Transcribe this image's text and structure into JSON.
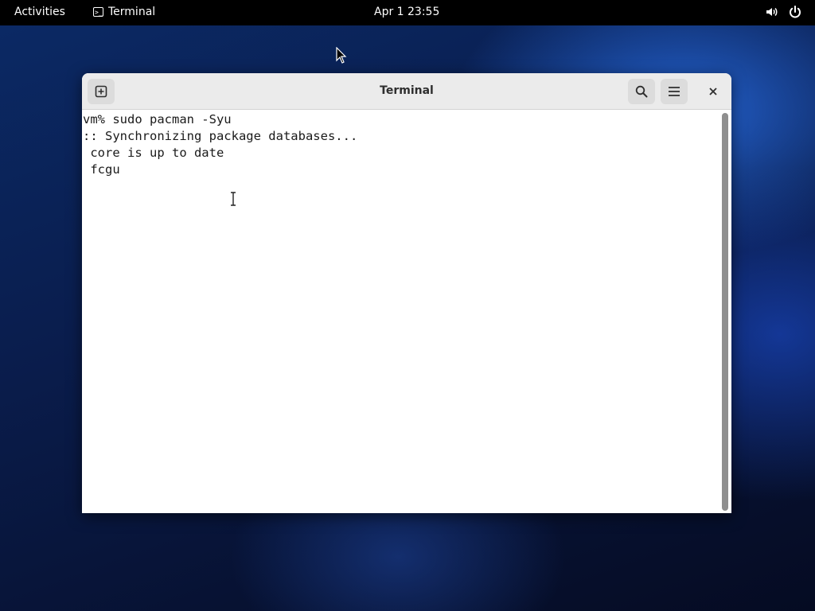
{
  "topbar": {
    "activities_label": "Activities",
    "app_name": "Terminal",
    "app_icon_glyph": ">_",
    "clock": "Apr 1  23:55",
    "volume_icon": "volume-icon",
    "power_icon": "power-icon"
  },
  "window": {
    "title": "Terminal",
    "buttons": {
      "new_tab_icon": "new-tab-icon",
      "search_icon": "search-icon",
      "menu_icon": "hamburger-menu-icon",
      "close_icon": "close-icon"
    }
  },
  "terminal": {
    "lines": [
      "vm% sudo pacman -Syu",
      ":: Synchronizing package databases...",
      " core is up to date",
      " fcgu"
    ]
  },
  "colors": {
    "topbar_bg": "#000000",
    "headerbar_bg": "#ebebeb",
    "terminal_bg": "#ffffff",
    "terminal_text": "#1a1a1a"
  }
}
